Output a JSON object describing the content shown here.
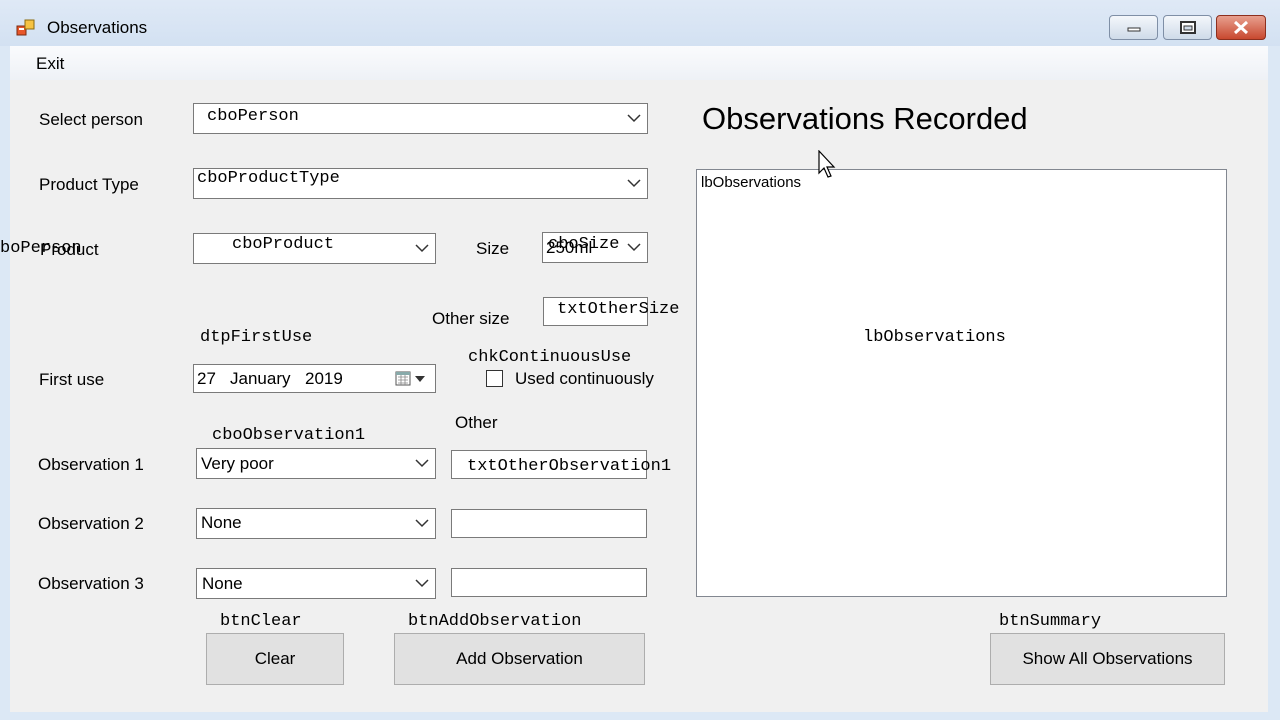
{
  "window": {
    "title": "Observations",
    "icon": "app-form-icon",
    "controls": [
      "minimize-icon",
      "maximize-icon",
      "close-icon"
    ]
  },
  "menu": {
    "exit_label": "Exit"
  },
  "form": {
    "select_person_label": "Select person",
    "person_combo_value": "cboPerson",
    "product_type_label": "Product Type",
    "product_type_value": "cboProductType",
    "product_label": "Product",
    "product_overlap_text": "boPerson",
    "product_value": "cboProduct",
    "size_label": "Size",
    "size_value": "250ml",
    "size_design_name": "cboSize",
    "other_size_label": "Other size",
    "other_size_value": "txtOtherSize",
    "first_use_design_name": "dtpFirstUse",
    "first_use_label": "First use",
    "first_use_day": "27",
    "first_use_month": "January",
    "first_use_year": "2019",
    "continuous_design_name": "chkContinuousUse",
    "continuous_label": "Used continuously",
    "other_label": "Other",
    "obs1_design_name": "cboObservation1",
    "obs1_label": "Observation 1",
    "obs1_value": "Very poor",
    "obs1_other_value": "txtOtherObservation1",
    "obs2_label": "Observation 2",
    "obs2_value": "None",
    "obs2_other_value": "",
    "obs3_label": "Observation 3",
    "obs3_value": "None",
    "obs3_other_value": ""
  },
  "buttons": {
    "clear_design_name": "btnClear",
    "clear_label": "Clear",
    "add_design_name": "btnAddObservation",
    "add_label": "Add Observation",
    "summary_design_name": "btnSummary",
    "summary_label": "Show All Observations"
  },
  "observations_panel": {
    "heading": "Observations Recorded",
    "list_name_top": "lbObservations",
    "list_name_center": "lbObservations"
  }
}
